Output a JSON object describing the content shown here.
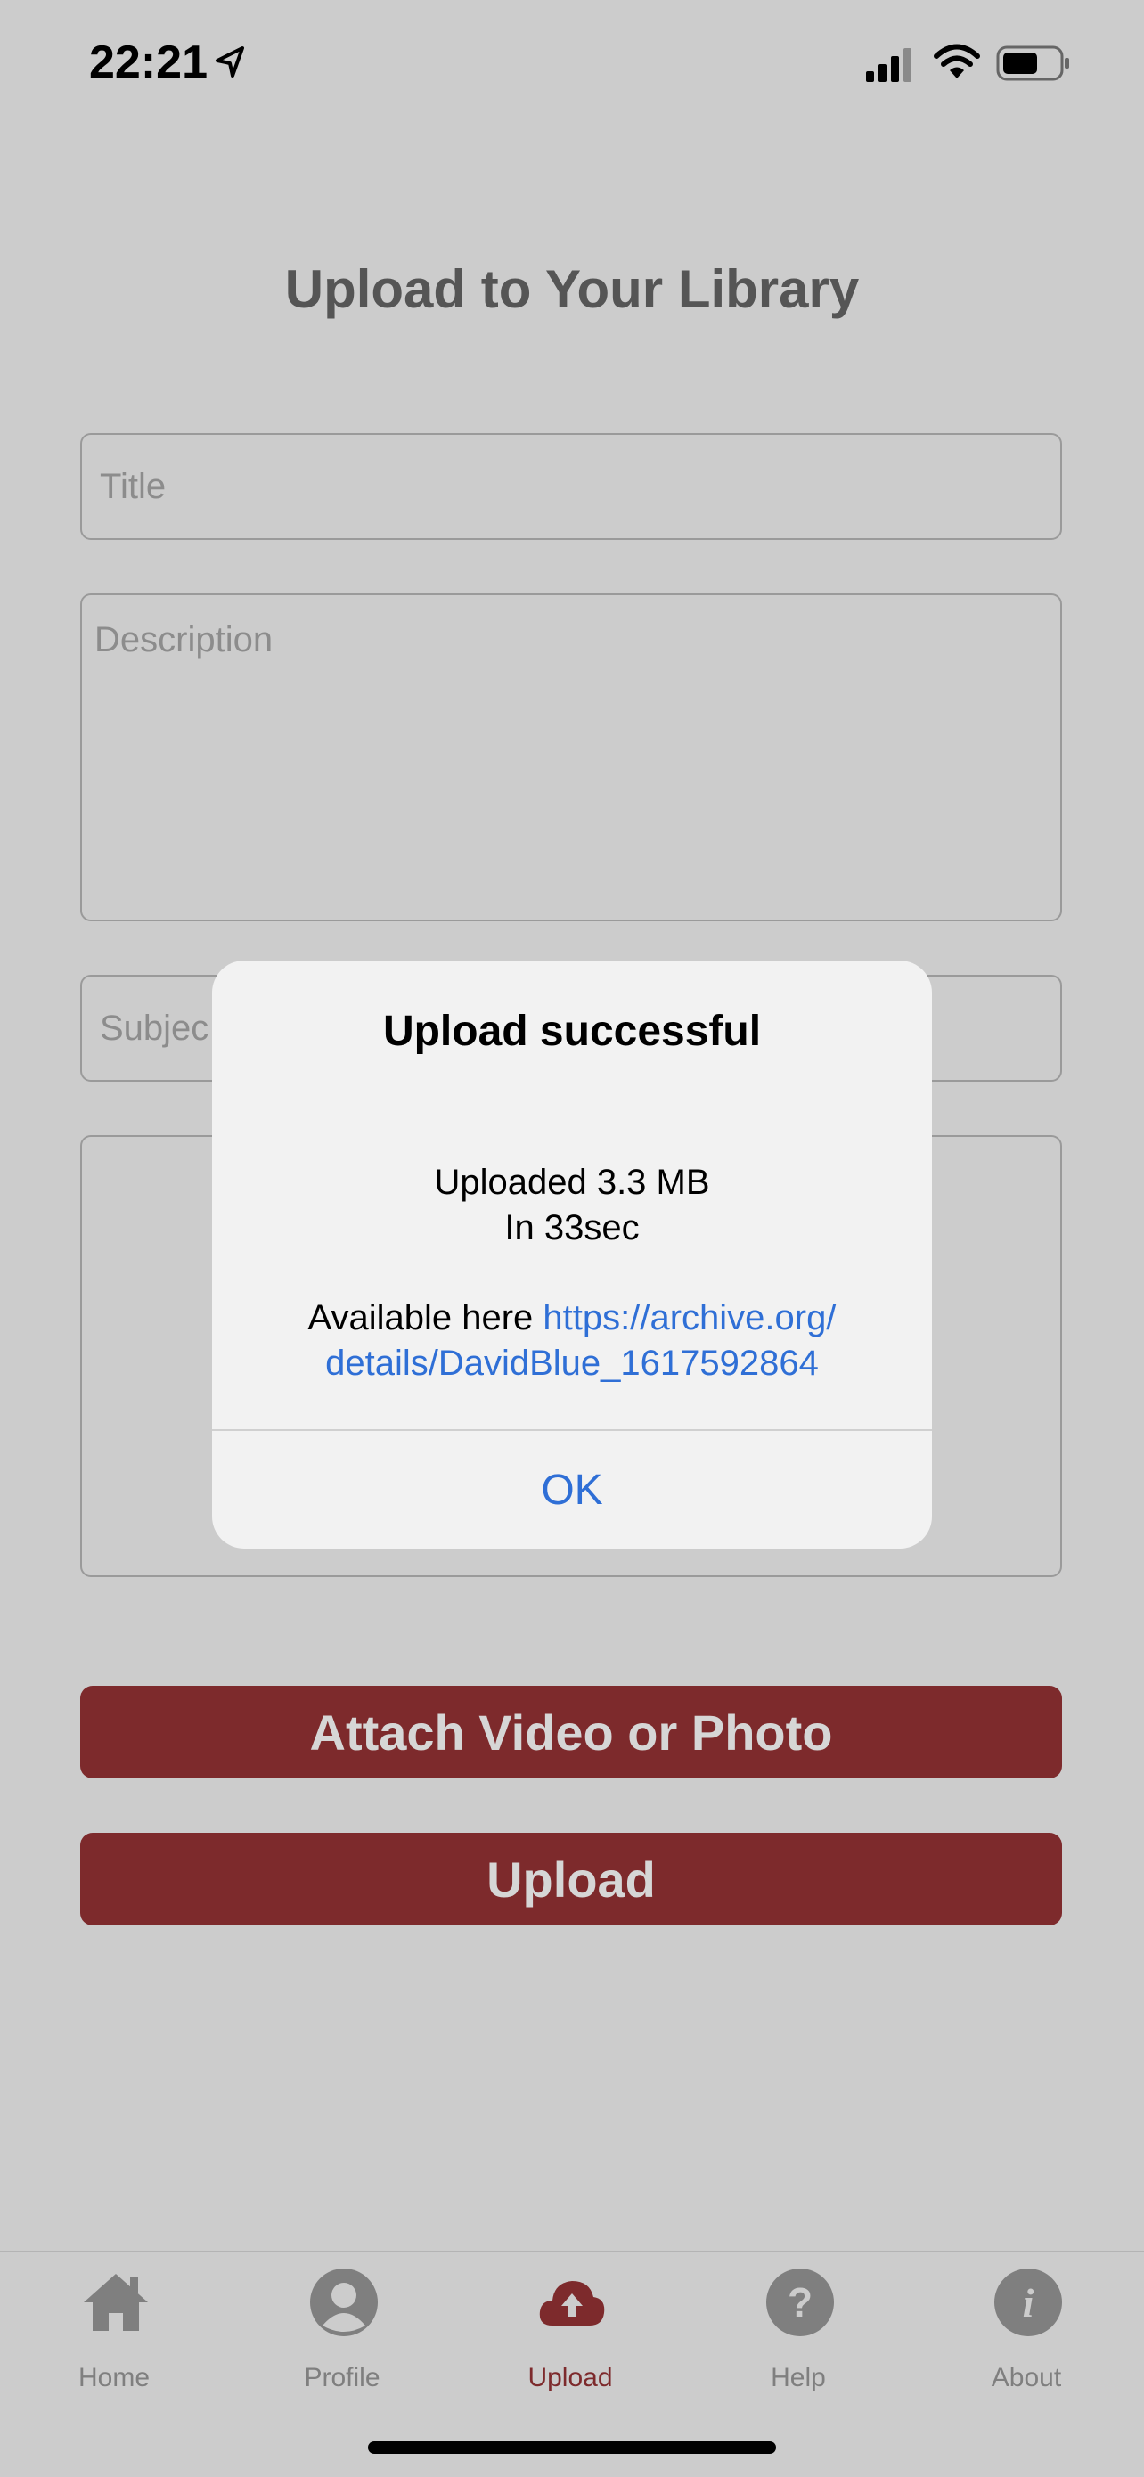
{
  "status_bar": {
    "time": "22:21"
  },
  "page": {
    "title": "Upload to Your Library"
  },
  "form": {
    "title_placeholder": "Title",
    "description_placeholder": "Description",
    "subject_placeholder": "Subjec"
  },
  "buttons": {
    "attach": "Attach Video or Photo",
    "upload": "Upload"
  },
  "dialog": {
    "title": "Upload successful",
    "line1": "Uploaded 3.3 MB",
    "line2": "In 33sec",
    "available_prefix": "Available here ",
    "link_part1": "https://archive.org/",
    "link_part2": "details/DavidBlue_1617592864",
    "ok": "OK"
  },
  "tabs": [
    {
      "label": "Home",
      "icon": "home-icon"
    },
    {
      "label": "Profile",
      "icon": "profile-icon"
    },
    {
      "label": "Upload",
      "icon": "cloud-upload-icon",
      "active": true
    },
    {
      "label": "Help",
      "icon": "help-icon"
    },
    {
      "label": "About",
      "icon": "info-icon"
    }
  ],
  "colors": {
    "accent": "#7d2a2c",
    "link": "#2f6fd6",
    "background": "#cccccc"
  }
}
